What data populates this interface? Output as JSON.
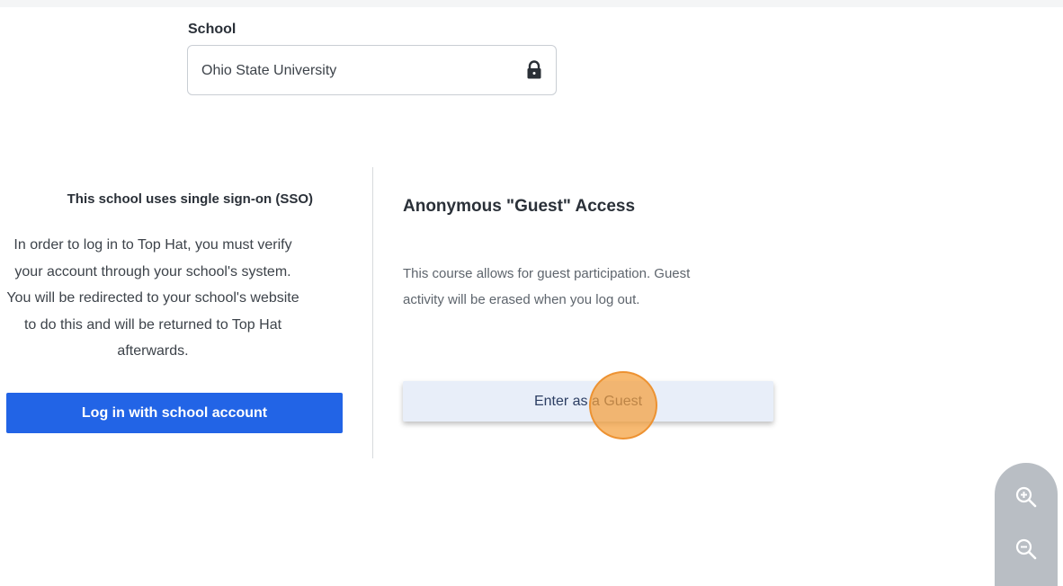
{
  "school": {
    "label": "School",
    "value": "Ohio State University",
    "locked_icon": "lock-icon"
  },
  "sso": {
    "title": "This school uses single sign-on (SSO)",
    "body_lines": [
      "In order to log in to Top Hat, you must verify",
      "your account through your school's system.",
      "You will be redirected to your school's website",
      "to do this and will be returned to Top Hat",
      "afterwards."
    ],
    "button_label": "Log in with school account",
    "button_color": "#2264e6"
  },
  "guest": {
    "title": "Anonymous \"Guest\" Access",
    "description_lines": [
      "This course allows for guest participation. Guest",
      "activity will be erased when you log out."
    ],
    "button_label": "Enter as a Guest"
  },
  "zoom": {
    "zoom_in_icon": "zoom-in-icon",
    "zoom_out_icon": "zoom-out-icon"
  },
  "colors": {
    "accent": "#2264e6",
    "click_marker": "#f4a03c"
  }
}
